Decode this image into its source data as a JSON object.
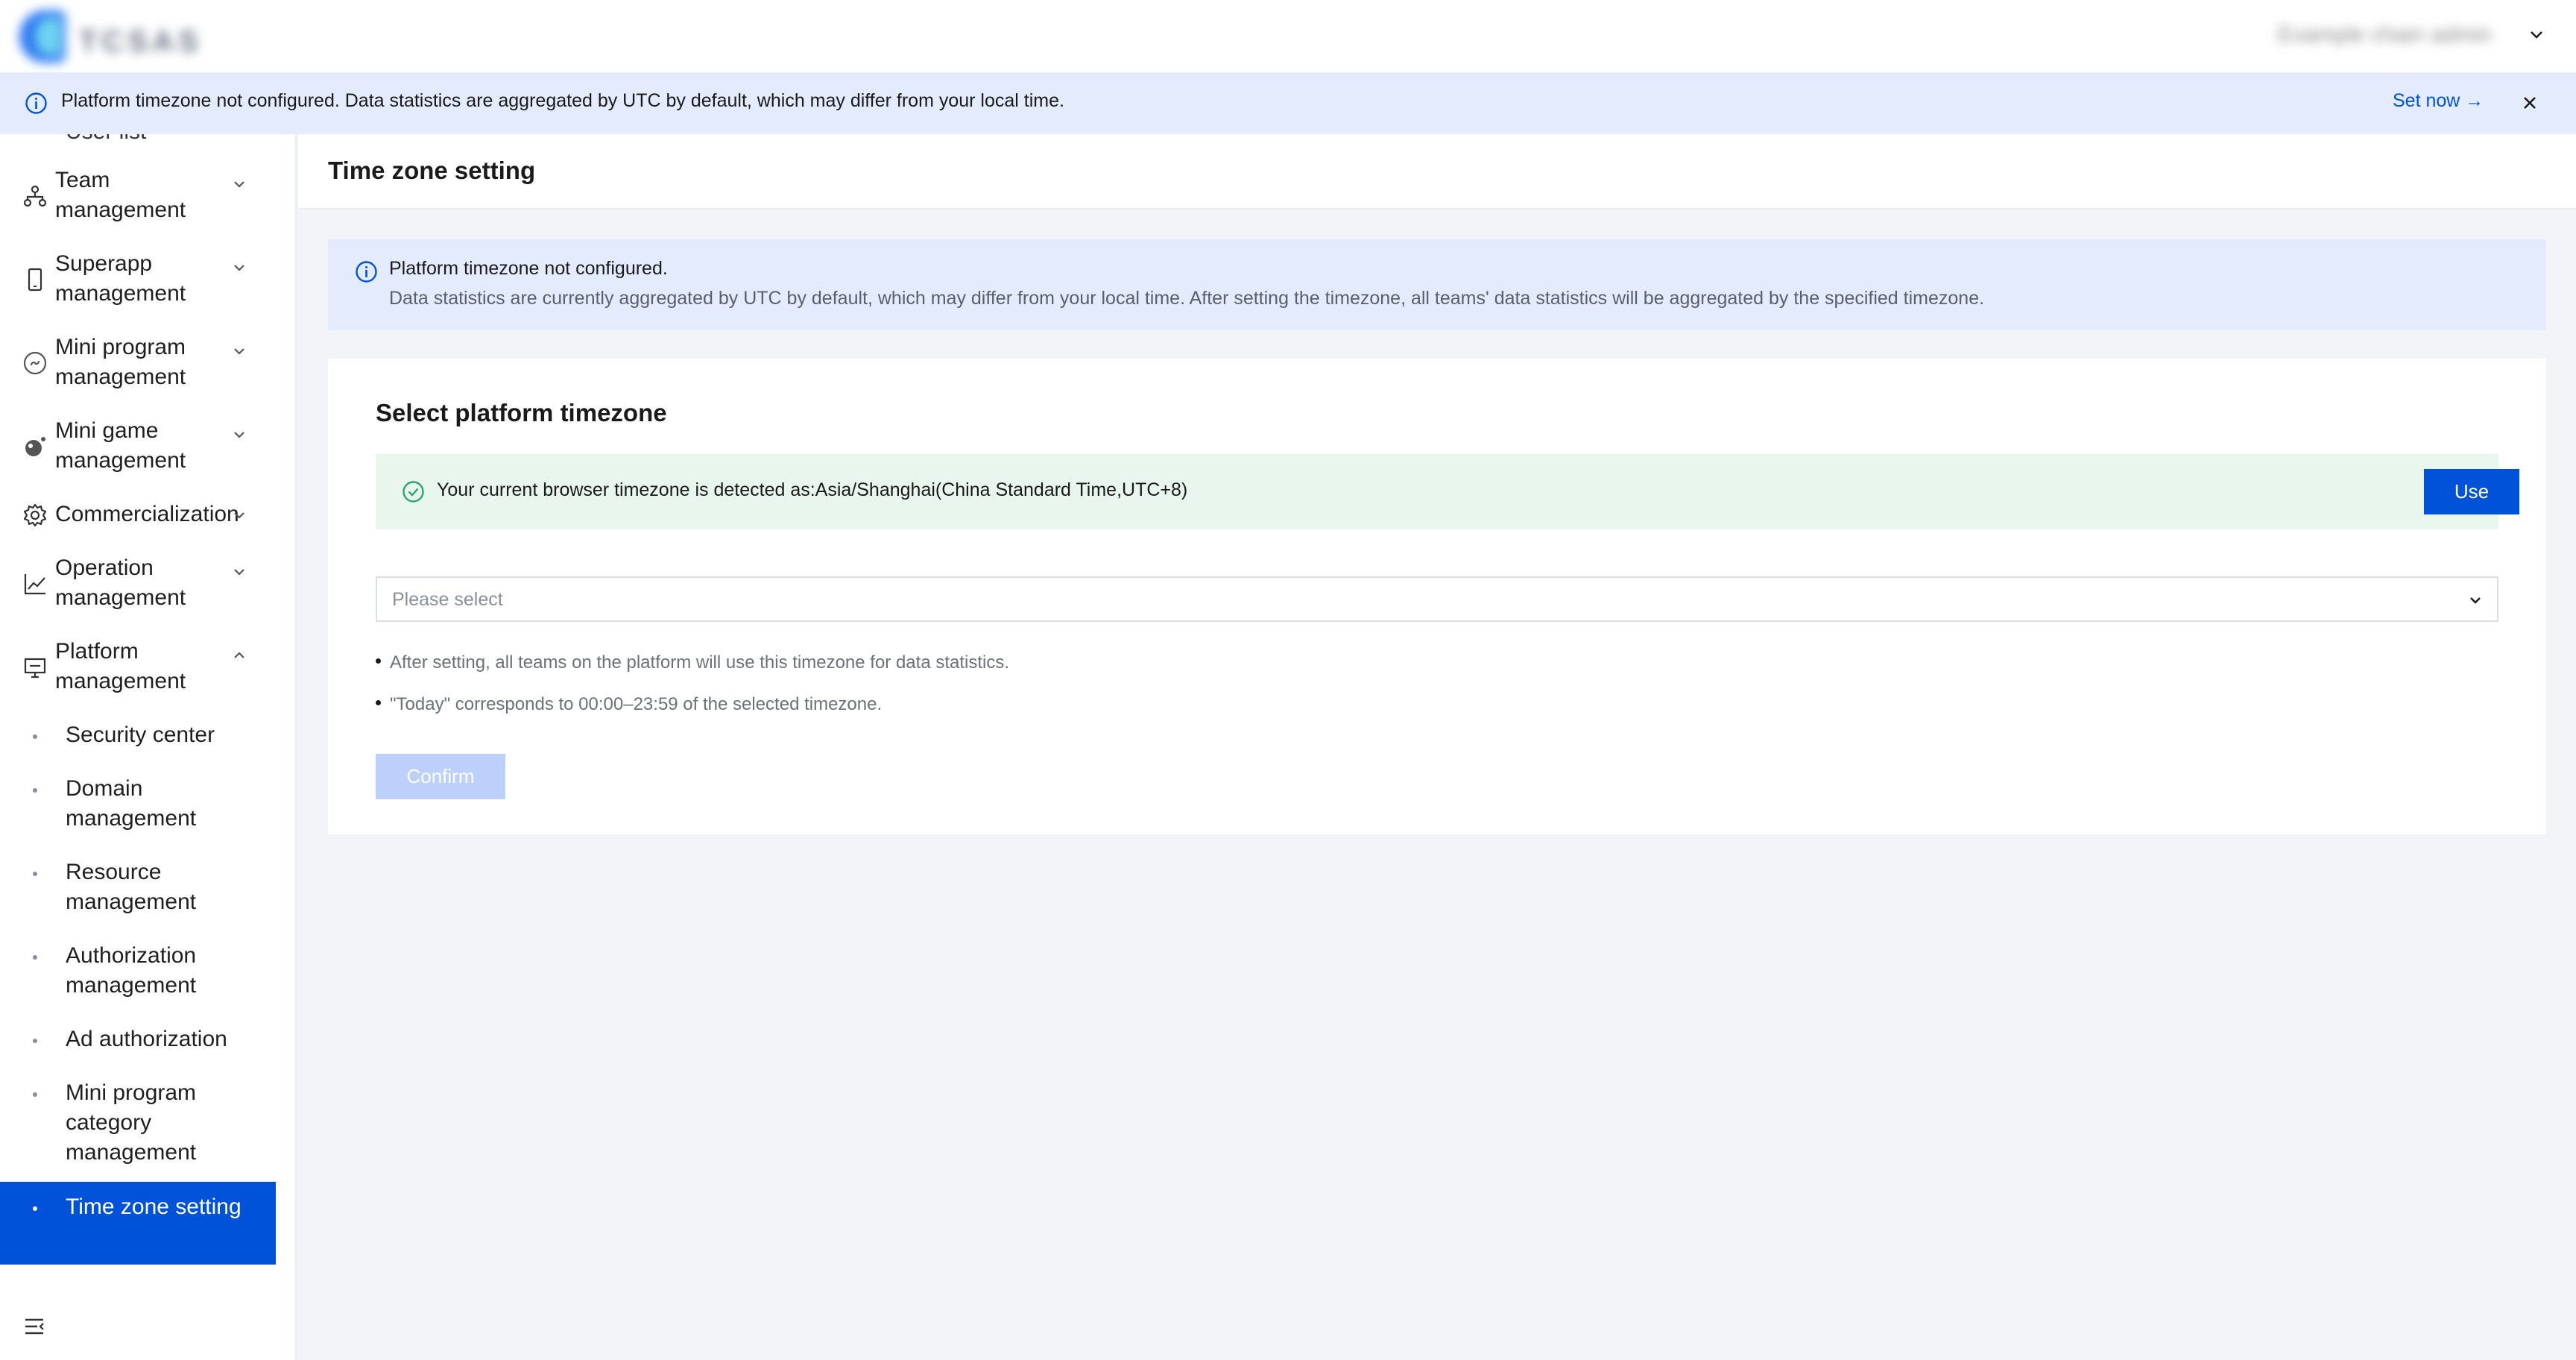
{
  "header": {
    "logo_text": "TCSAS",
    "user_name": "Example chain admin",
    "user_menu_icon": "chevron-down-icon"
  },
  "banner": {
    "message": "Platform timezone not configured. Data statistics are aggregated by UTC by default, which may differ from your local time.",
    "set_now_label": "Set now →",
    "icon": "info-icon",
    "close_icon": "close-icon"
  },
  "sidebar": {
    "cut_off_item": "User list",
    "items": [
      {
        "label": "Team management",
        "icon": "team-icon",
        "expanded": false
      },
      {
        "label": "Superapp management",
        "icon": "phone-icon",
        "expanded": false
      },
      {
        "label": "Mini program management",
        "icon": "link-icon",
        "expanded": false
      },
      {
        "label": "Mini game management",
        "icon": "game-icon",
        "expanded": false
      },
      {
        "label": "Commercialization",
        "icon": "gear-icon",
        "expanded": false
      },
      {
        "label": "Operation management",
        "icon": "chart-icon",
        "expanded": false
      },
      {
        "label": "Platform management",
        "icon": "monitor-icon",
        "expanded": true
      }
    ],
    "sub_items": [
      {
        "label": "Security center"
      },
      {
        "label": "Domain management"
      },
      {
        "label": "Resource management"
      },
      {
        "label": "Authorization management"
      },
      {
        "label": "Ad authorization"
      },
      {
        "label": "Mini program category management"
      },
      {
        "label": "Time zone setting",
        "active": true
      }
    ],
    "collapse_icon": "menu-fold-icon"
  },
  "page": {
    "title": "Time zone setting"
  },
  "info_box": {
    "title": "Platform timezone not configured.",
    "description": "Data statistics are currently aggregated by UTC by default, which may differ from your local time. After setting the timezone, all teams' data statistics will be aggregated by the specified timezone."
  },
  "card": {
    "title": "Select platform timezone",
    "detected_text": "Your current browser timezone is detected as:Asia/Shanghai(China Standard Time,UTC+8)",
    "use_label": "Use",
    "select_placeholder": "Please select",
    "notes": [
      "After setting, all teams on the platform will use this timezone for data statistics.",
      "\"Today\" corresponds to 00:00–23:59 of the selected timezone."
    ],
    "confirm_label": "Confirm"
  },
  "colors": {
    "primary": "#0052d9",
    "info_bg": "#e3ebfd",
    "success_bg": "#e8f6ee",
    "success": "#2ba471",
    "disabled_button": "#bcd0fb",
    "page_bg": "#f3f4f7"
  }
}
